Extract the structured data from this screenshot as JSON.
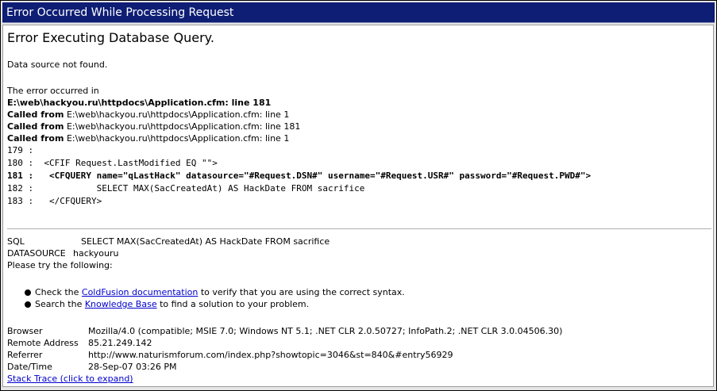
{
  "title": "Error Occurred While Processing Request",
  "heading": "Error Executing Database Query.",
  "message": "Data source not found.",
  "error_intro": "The error occurred in",
  "error_location": "E:\\web\\hackyou.ru\\httpdocs\\Application.cfm: line 181",
  "called_from": [
    {
      "label": "Called from",
      "text": "E:\\web\\hackyou.ru\\httpdocs\\Application.cfm: line 1"
    },
    {
      "label": "Called from",
      "text": "E:\\web\\hackyou.ru\\httpdocs\\Application.cfm: line 181"
    },
    {
      "label": "Called from",
      "text": "E:\\web\\hackyou.ru\\httpdocs\\Application.cfm: line 1"
    }
  ],
  "code_lines": [
    "179 :",
    "180 :  <CFIF Request.LastModified EQ \"\">",
    "181 :   <CFQUERY name=\"qLastHack\" datasource=\"#Request.DSN#\" username=\"#Request.USR#\" password=\"#Request.PWD#\">",
    "182 :            SELECT MAX(SacCreatedAt) AS HackDate FROM sacrifice",
    "183 :   </CFQUERY>"
  ],
  "sql": {
    "label": "SQL",
    "value": "SELECT MAX(SacCreatedAt) AS HackDate FROM sacrifice"
  },
  "datasource": {
    "label": "DATASOURCE",
    "value": "hackyouru"
  },
  "try_text": "Please try the following:",
  "suggestions": [
    {
      "before": "Check the ",
      "link": "ColdFusion documentation",
      "after": " to verify that you are using the correct syntax."
    },
    {
      "before": "Search the ",
      "link": "Knowledge Base",
      "after": " to find a solution to your problem."
    }
  ],
  "info": [
    {
      "label": "Browser",
      "value": "Mozilla/4.0 (compatible; MSIE 7.0; Windows NT 5.1; .NET CLR 2.0.50727; InfoPath.2; .NET CLR 3.0.04506.30)"
    },
    {
      "label": "Remote Address",
      "value": "85.21.249.142"
    },
    {
      "label": "Referrer",
      "value": "http://www.naturismforum.com/index.php?showtopic=3046&st=840&#entry56929"
    },
    {
      "label": "Date/Time",
      "value": "28-Sep-07 03:26 PM"
    }
  ],
  "stack_trace_link": "Stack Trace (click to expand)"
}
